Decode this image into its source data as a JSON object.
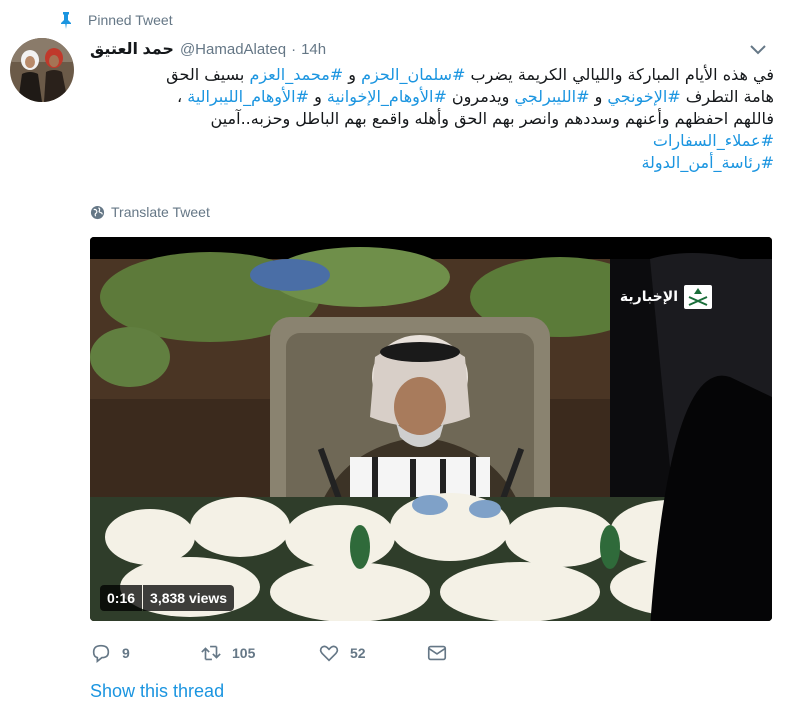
{
  "pinned": {
    "label": "Pinned Tweet",
    "icon": "pin-icon"
  },
  "author": {
    "display_name": "حمد العتيق",
    "handle": "@HamadAlateq",
    "separator": "·",
    "time": "14h"
  },
  "tweet": {
    "lines": [
      [
        {
          "text": "في هذه الأيام المباركة والليالي الكريمة يضرب ",
          "tag": false
        },
        {
          "text": "#سلمان_الحزم",
          "tag": true
        },
        {
          "text": " و ",
          "tag": false
        },
        {
          "text": "#محمد_العزم",
          "tag": true
        },
        {
          "text": " بسيف الحق",
          "tag": false
        }
      ],
      [
        {
          "text": "هامة التطرف ",
          "tag": false
        },
        {
          "text": "#الإخونجي",
          "tag": true
        },
        {
          "text": " و ",
          "tag": false
        },
        {
          "text": "#الليبرلجي",
          "tag": true
        },
        {
          "text": " ويدمرون ",
          "tag": false
        },
        {
          "text": "#الأوهام_الإخوانية",
          "tag": true
        },
        {
          "text": " و ",
          "tag": false
        },
        {
          "text": "#الأوهام_الليبرالية",
          "tag": true
        },
        {
          "text": " ،",
          "tag": false
        }
      ],
      [
        {
          "text": "فاللهم احفظهم وأعنهم وسددهم وانصر بهم الحق وأهله واقمع بهم الباطل وحزبه..آمين",
          "tag": false
        }
      ],
      [
        {
          "text": "#عملاء_السفارات",
          "tag": true
        }
      ],
      [
        {
          "text": "#رئاسة_أمن_الدولة",
          "tag": true
        }
      ]
    ]
  },
  "translate": {
    "label": "Translate Tweet"
  },
  "video": {
    "duration": "0:16",
    "views": "3,838 views",
    "channel_text": "الإخبارية"
  },
  "actions": {
    "reply_count": "9",
    "retweet_count": "105",
    "like_count": "52"
  },
  "show_thread": "Show this thread",
  "colors": {
    "link": "#1b95e0",
    "secondary": "#657786",
    "text": "#14171a"
  }
}
